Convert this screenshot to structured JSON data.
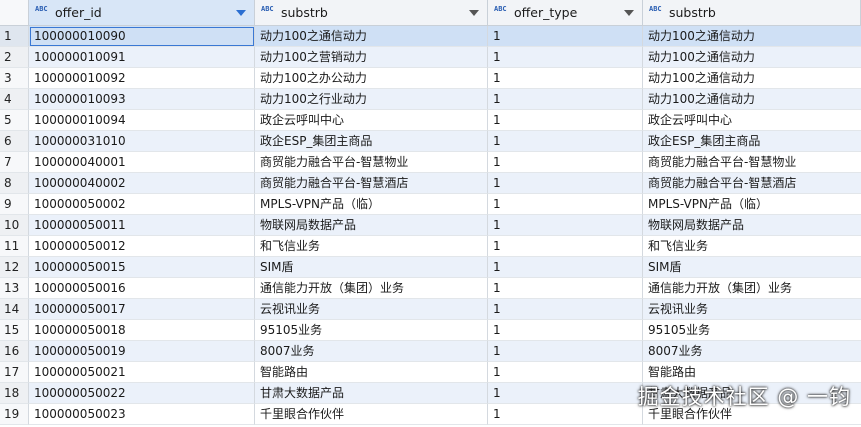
{
  "columns": [
    {
      "name": "offer_id",
      "type_icon": "ABC"
    },
    {
      "name": "substrb",
      "type_icon": "ABC"
    },
    {
      "name": "offer_type",
      "type_icon": "ABC"
    },
    {
      "name": "substrb",
      "type_icon": "ABC"
    }
  ],
  "rows": [
    {
      "n": "1",
      "offer_id": "100000010090",
      "substrb": "动力100之通信动力",
      "offer_type": "1",
      "substrb2": "动力100之通信动力"
    },
    {
      "n": "2",
      "offer_id": "100000010091",
      "substrb": "动力100之营销动力",
      "offer_type": "1",
      "substrb2": "动力100之通信动力"
    },
    {
      "n": "3",
      "offer_id": "100000010092",
      "substrb": "动力100之办公动力",
      "offer_type": "1",
      "substrb2": "动力100之通信动力"
    },
    {
      "n": "4",
      "offer_id": "100000010093",
      "substrb": "动力100之行业动力",
      "offer_type": "1",
      "substrb2": "动力100之通信动力"
    },
    {
      "n": "5",
      "offer_id": "100000010094",
      "substrb": "政企云呼叫中心",
      "offer_type": "1",
      "substrb2": "政企云呼叫中心"
    },
    {
      "n": "6",
      "offer_id": "100000031010",
      "substrb": "政企ESP_集团主商品",
      "offer_type": "1",
      "substrb2": "政企ESP_集团主商品"
    },
    {
      "n": "7",
      "offer_id": "100000040001",
      "substrb": "商贸能力融合平台-智慧物业",
      "offer_type": "1",
      "substrb2": "商贸能力融合平台-智慧物业"
    },
    {
      "n": "8",
      "offer_id": "100000040002",
      "substrb": "商贸能力融合平台-智慧酒店",
      "offer_type": "1",
      "substrb2": "商贸能力融合平台-智慧酒店"
    },
    {
      "n": "9",
      "offer_id": "100000050002",
      "substrb": "MPLS-VPN产品（临）",
      "offer_type": "1",
      "substrb2": "MPLS-VPN产品（临）"
    },
    {
      "n": "10",
      "offer_id": "100000050011",
      "substrb": "物联网局数据产品",
      "offer_type": "1",
      "substrb2": "物联网局数据产品"
    },
    {
      "n": "11",
      "offer_id": "100000050012",
      "substrb": "和飞信业务",
      "offer_type": "1",
      "substrb2": "和飞信业务"
    },
    {
      "n": "12",
      "offer_id": "100000050015",
      "substrb": "SIM盾",
      "offer_type": "1",
      "substrb2": "SIM盾"
    },
    {
      "n": "13",
      "offer_id": "100000050016",
      "substrb": "通信能力开放（集团）业务",
      "offer_type": "1",
      "substrb2": "通信能力开放（集团）业务"
    },
    {
      "n": "14",
      "offer_id": "100000050017",
      "substrb": "云视讯业务",
      "offer_type": "1",
      "substrb2": "云视讯业务"
    },
    {
      "n": "15",
      "offer_id": "100000050018",
      "substrb": "95105业务",
      "offer_type": "1",
      "substrb2": "95105业务"
    },
    {
      "n": "16",
      "offer_id": "100000050019",
      "substrb": "8007业务",
      "offer_type": "1",
      "substrb2": "8007业务"
    },
    {
      "n": "17",
      "offer_id": "100000050021",
      "substrb": "智能路由",
      "offer_type": "1",
      "substrb2": "智能路由"
    },
    {
      "n": "18",
      "offer_id": "100000050022",
      "substrb": "甘肃大数据产品",
      "offer_type": "1",
      "substrb2": "甘肃大数据产品"
    },
    {
      "n": "19",
      "offer_id": "100000050023",
      "substrb": "千里眼合作伙伴",
      "offer_type": "1",
      "substrb2": "千里眼合作伙伴"
    }
  ],
  "watermark": "掘金技术社区 @ 一钧",
  "colors": {
    "header_bg": "#f2f4f7",
    "selected_row": "#cfe0f5",
    "alt_row": "#ebf1fa",
    "accent": "#2c6fd1"
  }
}
